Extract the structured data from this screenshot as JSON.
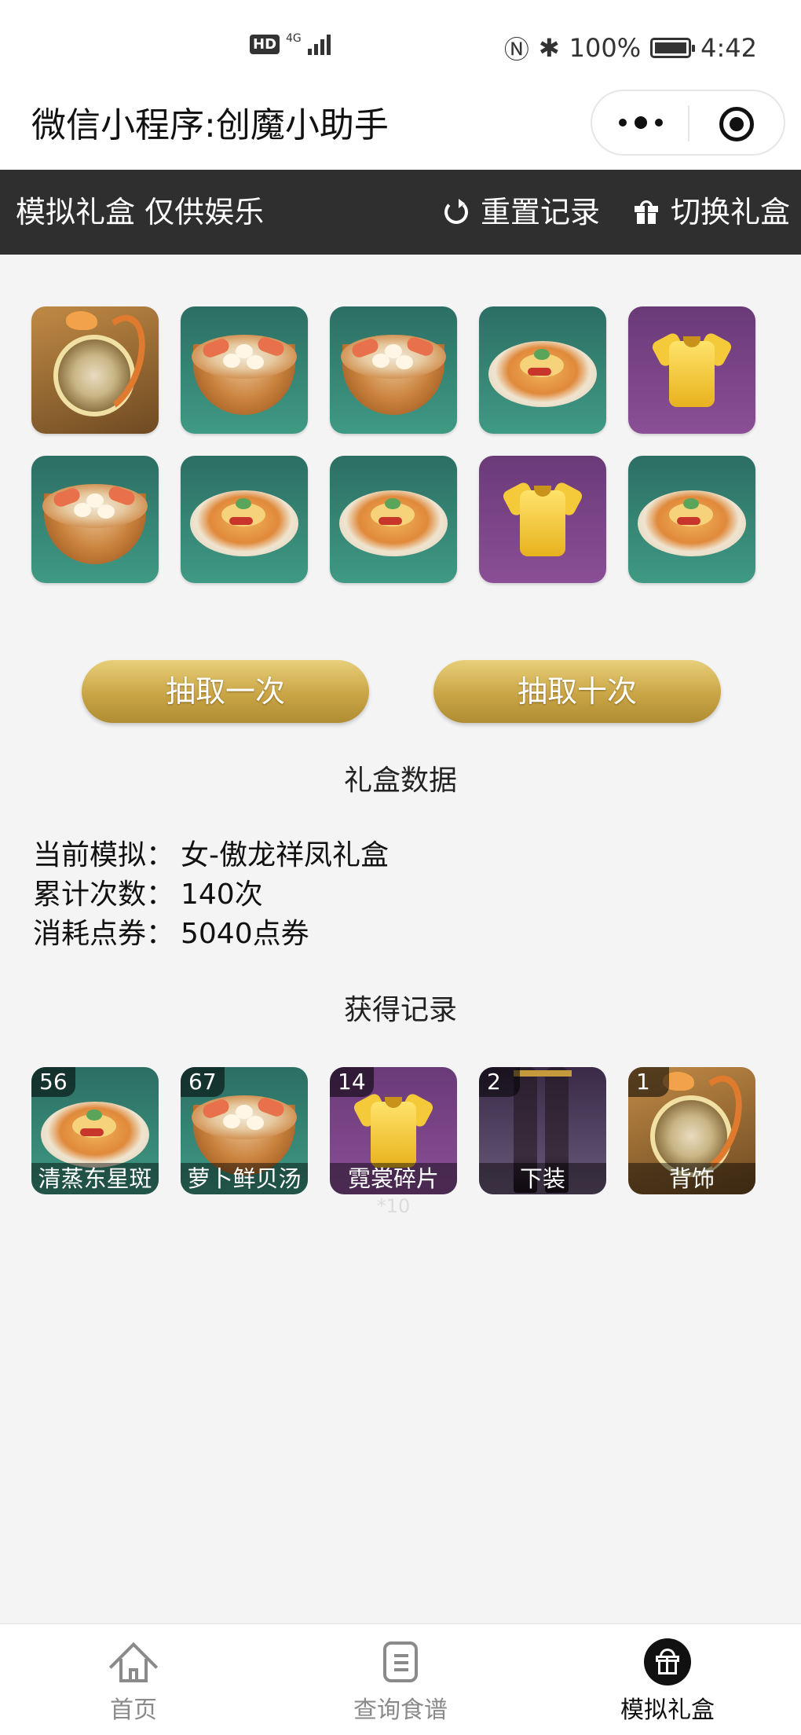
{
  "status_bar": {
    "hd": "HD",
    "network": "4G",
    "battery_pct": "100%",
    "time": "4:42"
  },
  "header": {
    "title": "微信小程序:创魔小助手"
  },
  "toolbar": {
    "title": "模拟礼盒 仅供娱乐",
    "reset_label": "重置记录",
    "switch_label": "切换礼盒"
  },
  "draw_grid": [
    {
      "kind": "dragon-ring",
      "bg": "gold"
    },
    {
      "kind": "soup",
      "bg": "teal"
    },
    {
      "kind": "soup",
      "bg": "teal"
    },
    {
      "kind": "fish",
      "bg": "teal"
    },
    {
      "kind": "shirt",
      "bg": "purple"
    },
    {
      "kind": "soup",
      "bg": "teal"
    },
    {
      "kind": "fish",
      "bg": "teal"
    },
    {
      "kind": "fish",
      "bg": "teal"
    },
    {
      "kind": "shirt",
      "bg": "purple"
    },
    {
      "kind": "fish",
      "bg": "teal"
    }
  ],
  "actions": {
    "draw_once": "抽取一次",
    "draw_ten": "抽取十次"
  },
  "stats": {
    "section_title": "礼盒数据",
    "current_label": "当前模拟：",
    "current_value": "女-傲龙祥凤礼盒",
    "count_label": "累计次数：",
    "count_value": "140次",
    "cost_label": "消耗点券：",
    "cost_value": "5040点券"
  },
  "records": {
    "section_title": "获得记录",
    "items": [
      {
        "count": "56",
        "name": "清蒸东星斑",
        "kind": "fish",
        "bg": "teal"
      },
      {
        "count": "67",
        "name": "萝卜鲜贝汤",
        "kind": "soup",
        "bg": "teal"
      },
      {
        "count": "14",
        "name": "霓裳碎片",
        "kind": "shirt",
        "bg": "purple",
        "sub": "*10"
      },
      {
        "count": "2",
        "name": "下装",
        "kind": "legs",
        "bg": "dark"
      },
      {
        "count": "1",
        "name": "背饰",
        "kind": "dragon-ring",
        "bg": "gold"
      }
    ]
  },
  "tabbar": {
    "home": "首页",
    "recipe": "查询食谱",
    "gift": "模拟礼盒",
    "active": "gift"
  },
  "colors": {
    "toolbar_bg": "#2f2f2f",
    "page_bg": "#f4f4f4",
    "gold_button": "#c9a545",
    "tile_teal": "#3f9a84",
    "tile_purple": "#8a4f96"
  }
}
